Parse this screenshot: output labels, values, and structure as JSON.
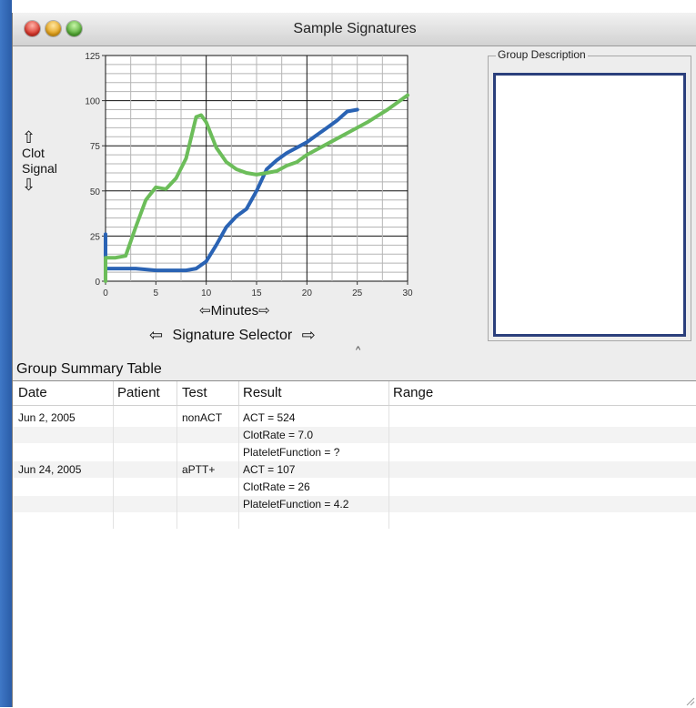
{
  "window": {
    "title": "Sample Signatures"
  },
  "chart": {
    "y_caption_top_icon": "up-arrow-icon",
    "y_caption_line1": "Clot",
    "y_caption_line2": "Signal",
    "y_caption_bottom_icon": "down-arrow-icon",
    "x_caption": "Minutes",
    "colors": {
      "blue": "#2a63b4",
      "green": "#6cbd5a"
    }
  },
  "chart_data": {
    "type": "line",
    "xlabel": "Minutes",
    "ylabel": "Clot Signal",
    "xlim": [
      0,
      30
    ],
    "ylim": [
      0,
      125
    ],
    "xticks": [
      0,
      5,
      10,
      15,
      20,
      25,
      30
    ],
    "yticks": [
      0,
      25,
      50,
      75,
      100,
      125
    ],
    "grid": true,
    "series": [
      {
        "color": "#2a63b4",
        "points": [
          [
            0,
            26
          ],
          [
            0,
            7
          ],
          [
            1,
            7
          ],
          [
            3,
            7
          ],
          [
            5,
            6
          ],
          [
            7,
            6
          ],
          [
            8,
            6
          ],
          [
            9,
            7
          ],
          [
            10,
            11
          ],
          [
            11,
            20
          ],
          [
            12,
            30
          ],
          [
            13,
            36
          ],
          [
            14,
            40
          ],
          [
            15,
            50
          ],
          [
            16,
            62
          ],
          [
            17,
            67
          ],
          [
            18,
            71
          ],
          [
            19,
            74
          ],
          [
            20,
            77
          ],
          [
            21,
            81
          ],
          [
            22,
            85
          ],
          [
            23,
            89
          ],
          [
            24,
            94
          ],
          [
            25,
            95
          ]
        ]
      },
      {
        "color": "#6cbd5a",
        "points": [
          [
            0,
            0
          ],
          [
            0,
            13
          ],
          [
            1,
            13
          ],
          [
            2,
            14
          ],
          [
            3,
            30
          ],
          [
            4,
            45
          ],
          [
            5,
            52
          ],
          [
            6,
            51
          ],
          [
            7,
            57
          ],
          [
            8,
            68
          ],
          [
            9,
            91
          ],
          [
            9.5,
            92
          ],
          [
            10,
            88
          ],
          [
            11,
            74
          ],
          [
            12,
            66
          ],
          [
            13,
            62
          ],
          [
            14,
            60
          ],
          [
            15,
            59
          ],
          [
            16,
            60
          ],
          [
            17,
            61
          ],
          [
            18,
            64
          ],
          [
            19,
            66
          ],
          [
            20,
            70
          ],
          [
            22,
            76
          ],
          [
            24,
            82
          ],
          [
            26,
            88
          ],
          [
            28,
            95
          ],
          [
            30,
            103
          ]
        ]
      }
    ]
  },
  "selector": {
    "label": "Signature Selector",
    "caret": "^"
  },
  "group_description": {
    "legend": "Group Description"
  },
  "table": {
    "title": "Group Summary Table",
    "headers": {
      "date": "Date",
      "patient": "Patient",
      "test": "Test",
      "result": "Result",
      "range": "Range"
    },
    "rows": [
      {
        "date": "Jun 2, 2005",
        "patient": "",
        "test": "nonACT",
        "result": "ACT = 524",
        "range": ""
      },
      {
        "date": "",
        "patient": "",
        "test": "",
        "result": "ClotRate = 7.0",
        "range": ""
      },
      {
        "date": "",
        "patient": "",
        "test": "",
        "result": "PlateletFunction = ?",
        "range": ""
      },
      {
        "date": "Jun 24, 2005",
        "patient": "",
        "test": "aPTT+",
        "result": "ACT = 107",
        "range": ""
      },
      {
        "date": "",
        "patient": "",
        "test": "",
        "result": "ClotRate = 26",
        "range": ""
      },
      {
        "date": "",
        "patient": "",
        "test": "",
        "result": "PlateletFunction = 4.2",
        "range": ""
      }
    ]
  }
}
